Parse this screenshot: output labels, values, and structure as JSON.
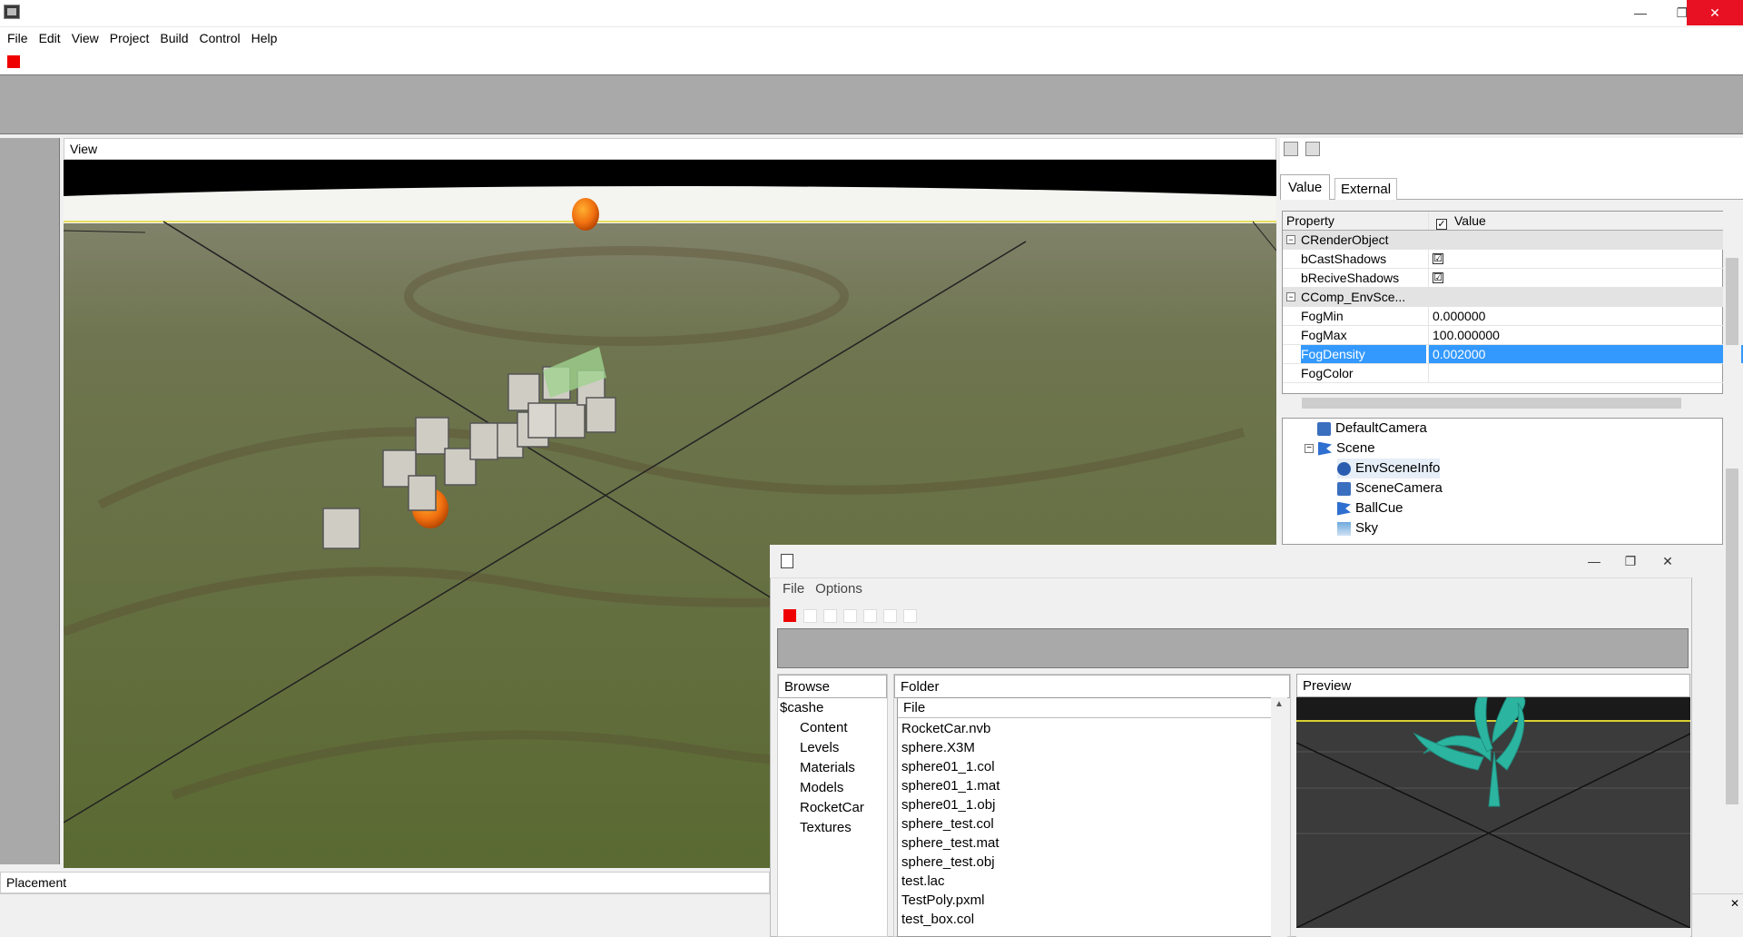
{
  "menubar": {
    "items": [
      "File",
      "Edit",
      "View",
      "Project",
      "Build",
      "Control",
      "Help"
    ]
  },
  "window_controls": {
    "minimize": "—",
    "maximize": "❐",
    "close": "✕"
  },
  "view_panel": {
    "title": "View"
  },
  "placement_panel": {
    "title": "Placement"
  },
  "property_panel": {
    "tabs": [
      "Value",
      "External"
    ],
    "header": {
      "property": "Property",
      "value": "Value"
    },
    "rows": [
      {
        "name": "CRenderObject",
        "value": ""
      },
      {
        "name": "bCastShadows",
        "value": "☑"
      },
      {
        "name": "bReciveShadows",
        "value": "☑"
      },
      {
        "name": "CComp_EnvSce...",
        "value": ""
      },
      {
        "name": "FogMin",
        "value": "0.000000"
      },
      {
        "name": "FogMax",
        "value": "100.000000"
      },
      {
        "name": "FogDensity",
        "value": "0.002000"
      },
      {
        "name": "FogColor",
        "value": ""
      }
    ]
  },
  "scene_tree": {
    "items": [
      "DefaultCamera",
      "Scene",
      "EnvSceneInfo",
      "SceneCamera",
      "BallCue",
      "Sky"
    ]
  },
  "browser_window": {
    "menu": [
      "File",
      "Options"
    ],
    "browse_title": "Browse",
    "folder_title": "Folder",
    "preview_title": "Preview",
    "file_column": "File",
    "browse_items": [
      "$cashe",
      "Content",
      "Levels",
      "Materials",
      "Models",
      "RocketCar",
      "Textures"
    ],
    "files": [
      "RocketCar.nvb",
      "sphere.X3M",
      "sphere01_1.col",
      "sphere01_1.mat",
      "sphere01_1.obj",
      "sphere_test.col",
      "sphere_test.mat",
      "sphere_test.obj",
      "test.lac",
      "TestPoly.pxml",
      "test_box.col"
    ]
  },
  "colors": {
    "accent_red": "#ee0000",
    "selection": "#3399ff",
    "panel_gray": "#a9a9a9"
  }
}
